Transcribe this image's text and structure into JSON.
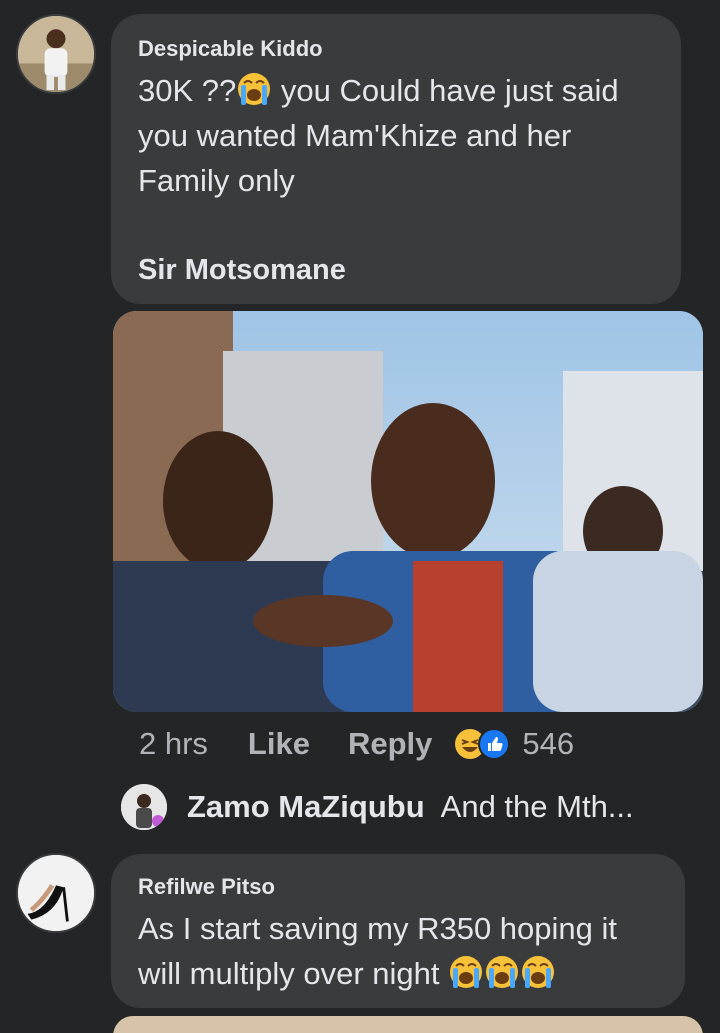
{
  "comments": [
    {
      "author": "Despicable Kiddo",
      "text_part1": "30K ??",
      "text_part2": " you Could have just said\nyou wanted Mam'Khize and her\nFamily only",
      "signature": "Sir Motsomane",
      "emoji": "crying-face-emoji",
      "meta": {
        "time": "2 hrs",
        "like_label": "Like",
        "reply_label": "Reply",
        "reactions": [
          "haha-reaction-icon",
          "like-reaction-icon"
        ],
        "reaction_count": "546"
      },
      "reply_preview": {
        "author": "Zamo MaZiqubu",
        "text": "And the Mth..."
      }
    },
    {
      "author": "Refilwe Pitso",
      "text": "As I start saving my R350 hoping it\nwill multiply over night ",
      "emojis": [
        "crying-face-emoji",
        "crying-face-emoji",
        "crying-face-emoji"
      ]
    }
  ],
  "colors": {
    "background": "#242526",
    "bubble": "#3a3b3c",
    "text_primary": "#e4e6eb",
    "text_secondary": "#b0b3b8",
    "like_blue": "#1877f2",
    "haha_yellow": "#f7c23a"
  }
}
